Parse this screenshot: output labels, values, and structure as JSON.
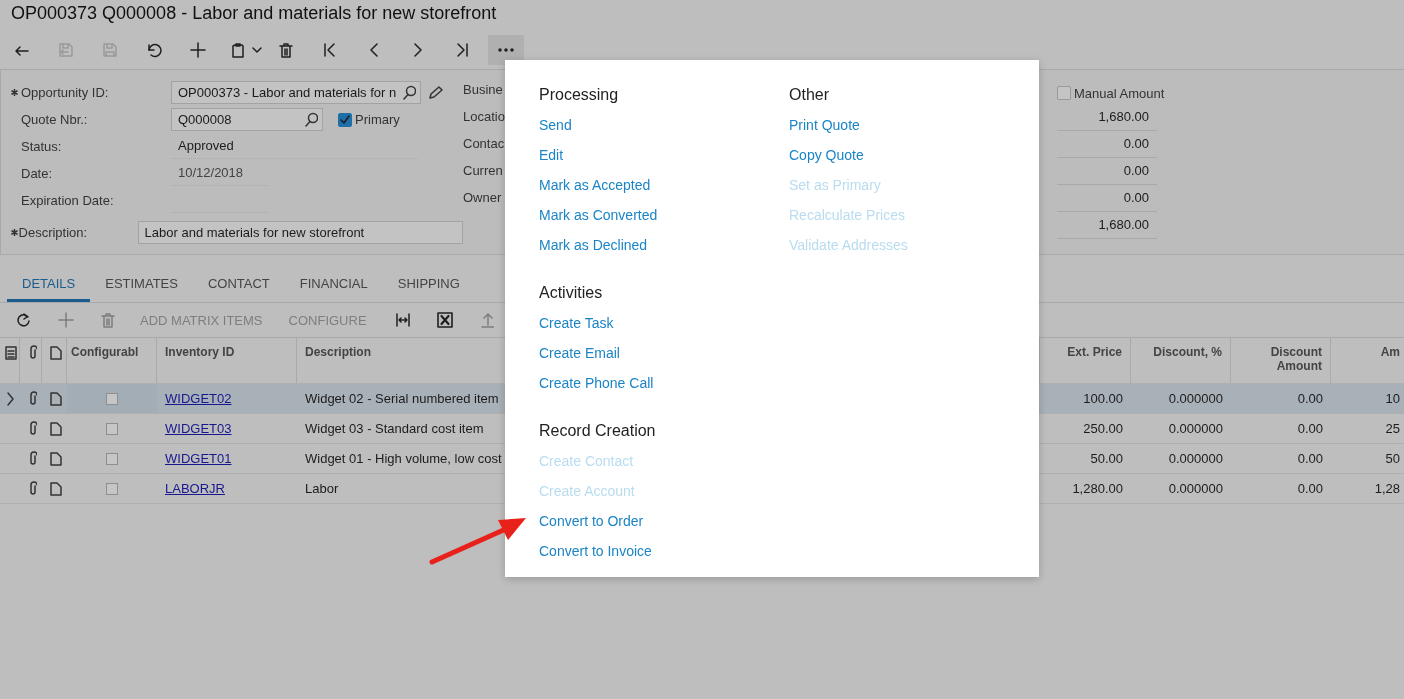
{
  "window": {
    "title": "OP000373 Q000008 - Labor and materials for new storefront"
  },
  "toolbar": [
    {
      "kind": "back",
      "disabled": false
    },
    {
      "kind": "save-close",
      "disabled": true
    },
    {
      "kind": "save",
      "disabled": true
    },
    {
      "kind": "undo",
      "disabled": false
    },
    {
      "kind": "add",
      "disabled": false
    },
    {
      "kind": "copy",
      "disabled": false
    },
    {
      "kind": "delete",
      "disabled": false
    },
    {
      "kind": "first",
      "disabled": false
    },
    {
      "kind": "prev",
      "disabled": false
    },
    {
      "kind": "next",
      "disabled": false
    },
    {
      "kind": "last",
      "disabled": false
    },
    {
      "kind": "more",
      "disabled": false,
      "expanded": true
    }
  ],
  "form": {
    "left": [
      {
        "kind": "lookup",
        "label": "Opportunity ID:",
        "required": true,
        "value": "OP000373 - Labor and materials for n",
        "edit": true
      },
      {
        "kind": "lookup-check",
        "label": "Quote Nbr.:",
        "required": false,
        "value": "Q000008",
        "check_label": "Primary",
        "checked": true
      },
      {
        "kind": "text",
        "label": "Status:",
        "required": false,
        "value": "Approved"
      },
      {
        "kind": "date",
        "label": "Date:",
        "required": false,
        "value": "10/12/2018"
      },
      {
        "kind": "date",
        "label": "Expiration Date:",
        "required": false
      },
      {
        "kind": "input",
        "label": "Description:",
        "required": true,
        "value": "Labor and materials for new storefront"
      }
    ],
    "middle_labels": [
      "Busine",
      "Locatio",
      "Contac",
      "Curren",
      "Owner"
    ],
    "manual_amount": {
      "label": "Manual Amount",
      "checked": false
    },
    "amounts": [
      "1,680.00",
      "0.00",
      "0.00",
      "0.00",
      "1,680.00"
    ]
  },
  "tabs": [
    {
      "label": "DETAILS",
      "selected": true
    },
    {
      "label": "ESTIMATES",
      "selected": false
    },
    {
      "label": "CONTACT",
      "selected": false
    },
    {
      "label": "FINANCIAL",
      "selected": false
    },
    {
      "label": "SHIPPING",
      "selected": false
    }
  ],
  "grid_toolbar": [
    {
      "kind": "refresh",
      "disabled": false
    },
    {
      "kind": "add",
      "disabled": true
    },
    {
      "kind": "delete",
      "disabled": true
    },
    {
      "kind": "text",
      "label": "ADD MATRIX ITEMS",
      "disabled": true
    },
    {
      "kind": "text",
      "label": "CONFIGURE",
      "disabled": true
    },
    {
      "kind": "fit",
      "disabled": false
    },
    {
      "kind": "excel",
      "disabled": false
    },
    {
      "kind": "upload",
      "disabled": true
    }
  ],
  "table": {
    "columns": [
      "Configurabl",
      "Inventory ID",
      "Description",
      "Ext. Price",
      "Discount, %",
      "Discount Amount",
      "Am"
    ],
    "rows": [
      {
        "selected": true,
        "configurable": false,
        "inventory_id": "WIDGET02",
        "description": "Widget 02 - Serial numbered item",
        "ext_price": "100.00",
        "discount_pct": "0.000000",
        "discount_amount": "0.00",
        "amount": "10"
      },
      {
        "selected": false,
        "configurable": false,
        "inventory_id": "WIDGET03",
        "description": "Widget 03 - Standard cost item",
        "ext_price": "250.00",
        "discount_pct": "0.000000",
        "discount_amount": "0.00",
        "amount": "25"
      },
      {
        "selected": false,
        "configurable": false,
        "inventory_id": "WIDGET01",
        "description": "Widget 01 - High volume, low cost",
        "ext_price": "50.00",
        "discount_pct": "0.000000",
        "discount_amount": "0.00",
        "amount": "50"
      },
      {
        "selected": false,
        "configurable": false,
        "inventory_id": "LABORJR",
        "description": "Labor",
        "ext_price": "1,280.00",
        "discount_pct": "0.000000",
        "discount_amount": "0.00",
        "amount": "1,28"
      }
    ]
  },
  "menu": {
    "columns": [
      {
        "sections": [
          {
            "title": "Processing",
            "items": [
              {
                "label": "Send",
                "disabled": false
              },
              {
                "label": "Edit",
                "disabled": false
              },
              {
                "label": "Mark as Accepted",
                "disabled": false
              },
              {
                "label": "Mark as Converted",
                "disabled": false
              },
              {
                "label": "Mark as Declined",
                "disabled": false
              }
            ]
          },
          {
            "title": "Activities",
            "items": [
              {
                "label": "Create Task",
                "disabled": false
              },
              {
                "label": "Create Email",
                "disabled": false
              },
              {
                "label": "Create Phone Call",
                "disabled": false
              }
            ]
          },
          {
            "title": "Record Creation",
            "items": [
              {
                "label": "Create Contact",
                "disabled": true
              },
              {
                "label": "Create Account",
                "disabled": true
              },
              {
                "label": "Convert to Order",
                "disabled": false
              },
              {
                "label": "Convert to Invoice",
                "disabled": false
              }
            ]
          }
        ]
      },
      {
        "sections": [
          {
            "title": "Other",
            "items": [
              {
                "label": "Print Quote",
                "disabled": false
              },
              {
                "label": "Copy Quote",
                "disabled": false
              },
              {
                "label": "Set as Primary",
                "disabled": true
              },
              {
                "label": "Recalculate Prices",
                "disabled": true
              },
              {
                "label": "Validate Addresses",
                "disabled": true
              }
            ]
          }
        ]
      }
    ]
  }
}
